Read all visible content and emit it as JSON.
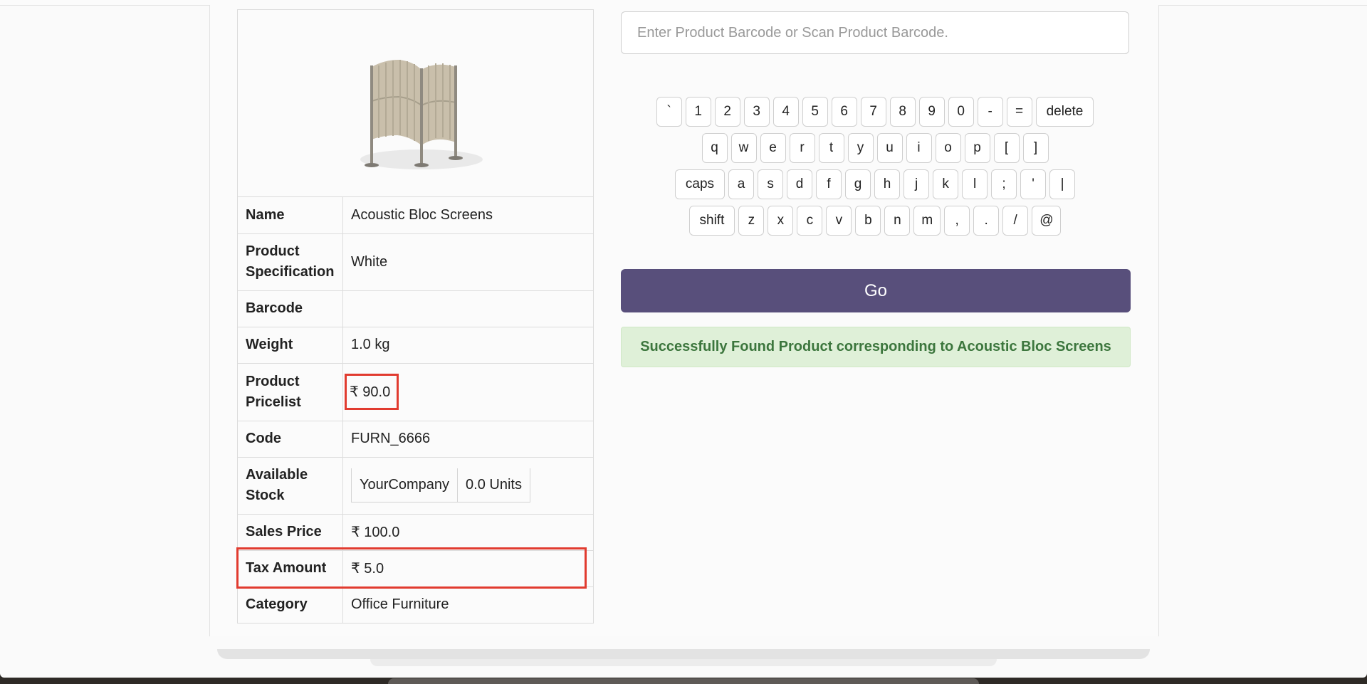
{
  "product": {
    "rows": [
      {
        "label": "Name",
        "value": "Acoustic Bloc Screens"
      },
      {
        "label": "Product Specification",
        "value": "White"
      },
      {
        "label": "Barcode",
        "value": ""
      },
      {
        "label": "Weight",
        "value": "1.0 kg"
      },
      {
        "label": "Product Pricelist",
        "value": "₹ 90.0"
      },
      {
        "label": "Code",
        "value": "FURN_6666"
      },
      {
        "label": "Available Stock",
        "company": "YourCompany",
        "units": "0.0 Units"
      },
      {
        "label": "Sales Price",
        "value": "₹ 100.0"
      },
      {
        "label": "Tax Amount",
        "value": "₹ 5.0"
      },
      {
        "label": "Category",
        "value": "Office Furniture"
      }
    ]
  },
  "search": {
    "placeholder": "Enter Product Barcode or Scan Product Barcode.",
    "value": ""
  },
  "keyboard": {
    "row1": [
      "`",
      "1",
      "2",
      "3",
      "4",
      "5",
      "6",
      "7",
      "8",
      "9",
      "0",
      "-",
      "=",
      "delete"
    ],
    "row2": [
      "q",
      "w",
      "e",
      "r",
      "t",
      "y",
      "u",
      "i",
      "o",
      "p",
      "[",
      "]"
    ],
    "row3": [
      "caps",
      "a",
      "s",
      "d",
      "f",
      "g",
      "h",
      "j",
      "k",
      "l",
      ";",
      "'",
      "|"
    ],
    "row4": [
      "shift",
      "z",
      "x",
      "c",
      "v",
      "b",
      "n",
      "m",
      ",",
      ".",
      "/",
      "@"
    ]
  },
  "go_label": "Go",
  "alert_message": "Successfully Found Product corresponding to Acoustic Bloc Screens",
  "colors": {
    "accent": "#584f7b",
    "success_bg": "#dff0d8",
    "success_text": "#3c763d",
    "highlight": "#e13b2f"
  }
}
